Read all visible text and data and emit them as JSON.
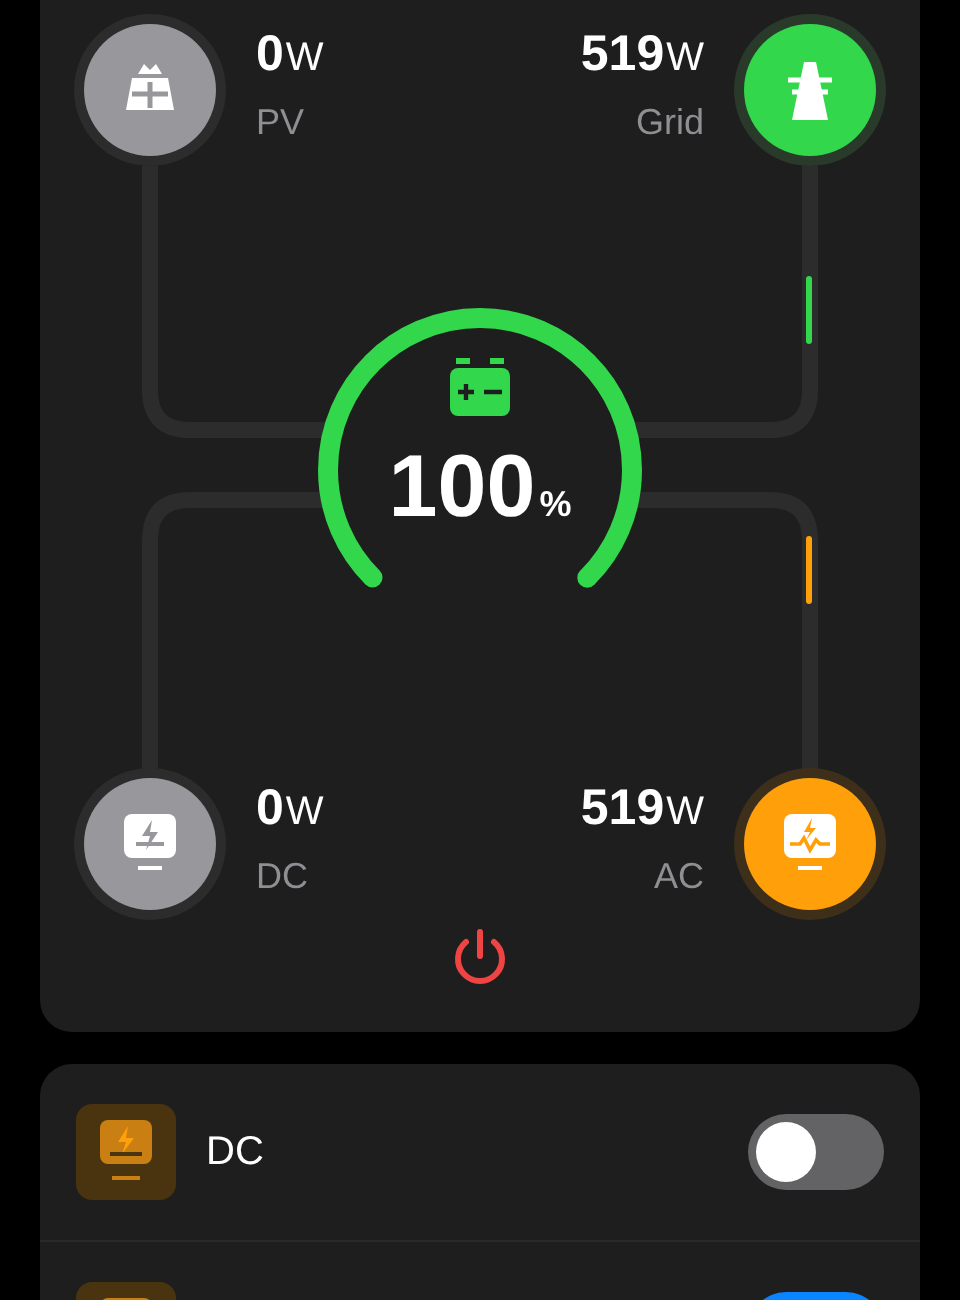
{
  "energy_flow": {
    "nodes": [
      {
        "kind": "pv",
        "value": "0",
        "unit": "W",
        "label": "PV",
        "color": "#98979c",
        "flowing": false
      },
      {
        "kind": "grid",
        "value": "519",
        "unit": "W",
        "label": "Grid",
        "color": "#32d74b",
        "flowing": true
      },
      {
        "kind": "dc",
        "value": "0",
        "unit": "W",
        "label": "DC",
        "color": "#98979c",
        "flowing": false
      },
      {
        "kind": "ac",
        "value": "519",
        "unit": "W",
        "label": "AC",
        "color": "#ff9f0a",
        "flowing": true
      }
    ],
    "battery": {
      "value": "100",
      "unit": "%"
    }
  },
  "outputs": [
    {
      "label": "DC",
      "on": false
    },
    {
      "on": true
    }
  ]
}
